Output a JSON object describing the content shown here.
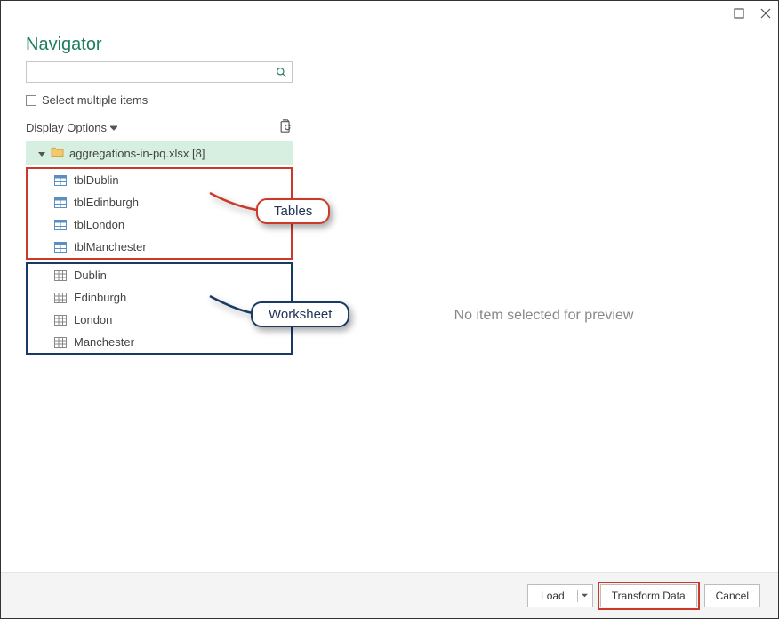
{
  "window": {
    "title": "Navigator"
  },
  "search": {
    "placeholder": ""
  },
  "multi_select": {
    "label": "Select multiple items"
  },
  "display_options": {
    "label": "Display Options"
  },
  "tree": {
    "file_label": "aggregations-in-pq.xlsx [8]",
    "tables": [
      {
        "label": "tblDublin"
      },
      {
        "label": "tblEdinburgh"
      },
      {
        "label": "tblLondon"
      },
      {
        "label": "tblManchester"
      }
    ],
    "sheets": [
      {
        "label": "Dublin"
      },
      {
        "label": "Edinburgh"
      },
      {
        "label": "London"
      },
      {
        "label": "Manchester"
      }
    ]
  },
  "preview": {
    "empty_text": "No item selected for preview"
  },
  "callouts": {
    "tables": "Tables",
    "worksheet": "Worksheet"
  },
  "footer": {
    "load_label": "Load",
    "transform_label": "Transform Data",
    "cancel_label": "Cancel"
  }
}
